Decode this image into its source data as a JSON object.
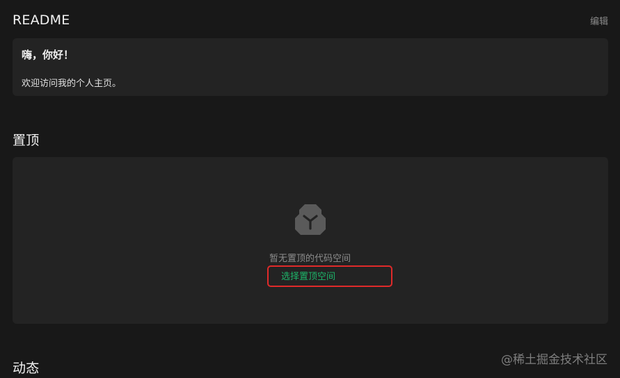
{
  "readme": {
    "title": "README",
    "edit_label": "编辑",
    "heading": "嗨，你好！",
    "text": "欢迎访问我的个人主页。"
  },
  "pinned": {
    "title": "置顶",
    "empty_icon": "cube-box-icon",
    "empty_text": "暂无置顶的代码空间",
    "choose_label": "选择置顶空间"
  },
  "activity": {
    "title": "动态"
  },
  "watermark": "@稀土掘金技术社区",
  "colors": {
    "background": "#181818",
    "card": "#232323",
    "accent_link": "#1db56a",
    "highlight_border": "#e02a2a"
  }
}
